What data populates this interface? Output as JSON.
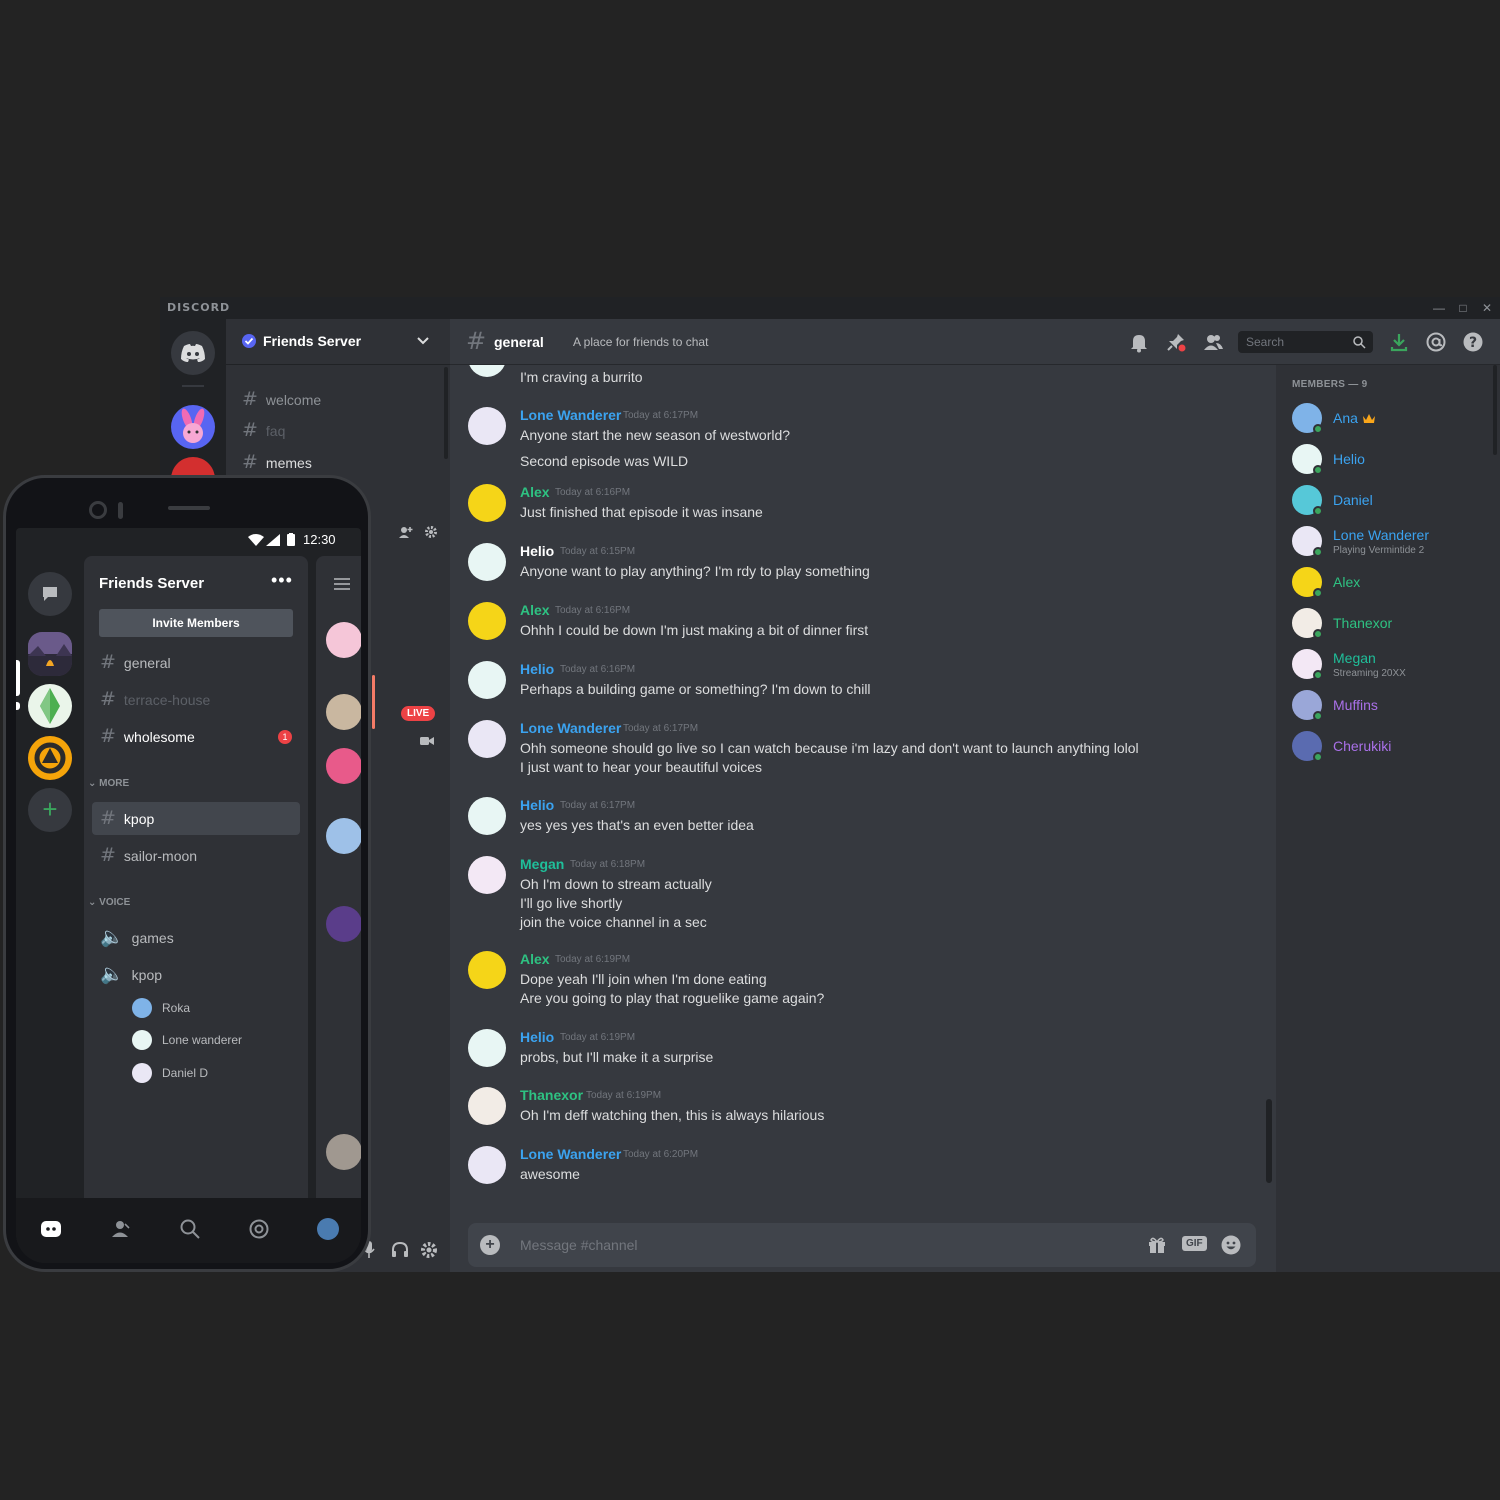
{
  "desktop": {
    "brand": "DISCORD",
    "server": {
      "name": "Friends Server"
    },
    "channels": [
      {
        "name": "welcome",
        "state": "normal"
      },
      {
        "name": "faq",
        "state": "dim"
      },
      {
        "name": "memes",
        "state": "active"
      }
    ],
    "live_label": "LIVE",
    "chat": {
      "channel_name": "general",
      "topic": "A place for friends to chat",
      "search_placeholder": "Search",
      "composer_placeholder": "Message #channel",
      "gif_label": "GIF"
    },
    "messages": [
      {
        "id": "m0",
        "author": "",
        "time": "",
        "lines": [
          "I'm craving a burrito"
        ]
      },
      {
        "id": "m1",
        "author": "Lone Wanderer",
        "time": "Today at 6:17PM",
        "lines": [
          "Anyone start the new season of westworld?"
        ]
      },
      {
        "id": "m1b",
        "author": "",
        "time": "",
        "lines": [
          "Second episode was WILD"
        ]
      },
      {
        "id": "m2",
        "author": "Alex",
        "time": "Today at 6:16PM",
        "lines": [
          "Just finished that episode it was insane"
        ]
      },
      {
        "id": "m3",
        "author": "Helio",
        "time": "Today at 6:15PM",
        "lines": [
          "Anyone want to play anything? I'm rdy to play something"
        ]
      },
      {
        "id": "m4",
        "author": "Alex",
        "time": "Today at 6:16PM",
        "lines": [
          "Ohhh I could be down I'm just making a bit of dinner first"
        ]
      },
      {
        "id": "m5",
        "author": "Helio",
        "time": "Today at 6:16PM",
        "lines": [
          "Perhaps a building game or something? I'm down to chill"
        ]
      },
      {
        "id": "m6",
        "author": "Lone Wanderer",
        "time": "Today at 6:17PM",
        "lines": [
          "Ohh someone should go live so I can watch because i'm lazy and don't want to launch anything lolol",
          "I just want to hear your beautiful voices"
        ]
      },
      {
        "id": "m7",
        "author": "Helio",
        "time": "Today at 6:17PM",
        "lines": [
          "yes yes yes that's an even better idea"
        ]
      },
      {
        "id": "m8",
        "author": "Megan",
        "time": "Today at 6:18PM",
        "lines": [
          "Oh I'm down to stream actually",
          "I'll go live shortly",
          "join the voice channel in a sec"
        ]
      },
      {
        "id": "m9",
        "author": "Alex",
        "time": "Today at 6:19PM",
        "lines": [
          "Dope yeah I'll join when I'm done eating",
          "Are you going to play that roguelike game again?"
        ]
      },
      {
        "id": "m10",
        "author": "Helio",
        "time": "Today at 6:19PM",
        "lines": [
          "probs, but I'll make it a surprise"
        ]
      },
      {
        "id": "m11",
        "author": "Thanexor",
        "time": "Today at 6:19PM",
        "lines": [
          "Oh I'm deff watching then, this is always hilarious"
        ]
      },
      {
        "id": "m12",
        "author": "Lone Wanderer",
        "time": "Today at 6:20PM",
        "lines": [
          "awesome"
        ]
      }
    ],
    "members": {
      "title": "MEMBERS — 9",
      "list": [
        {
          "name": "Ana",
          "sub": ""
        },
        {
          "name": "Helio",
          "sub": ""
        },
        {
          "name": "Daniel",
          "sub": ""
        },
        {
          "name": "Lone Wanderer",
          "sub": "Playing Vermintide 2"
        },
        {
          "name": "Alex",
          "sub": ""
        },
        {
          "name": "Thanexor",
          "sub": ""
        },
        {
          "name": "Megan",
          "sub": "Streaming 20XX"
        },
        {
          "name": "Muffins",
          "sub": ""
        },
        {
          "name": "Cherukiki",
          "sub": ""
        }
      ]
    },
    "colors": {
      "blue": "#3ba3f0",
      "green": "#2ec282",
      "purple": "#a970e8",
      "online": "#3ba55d",
      "danger": "#ed4245"
    }
  },
  "phone": {
    "clock": "12:30",
    "server_name": "Friends Server",
    "more_dots": "•••",
    "invite_label": "Invite Members",
    "channels": [
      {
        "name": "general",
        "state": "normal"
      },
      {
        "name": "terrace-house",
        "state": "dim"
      },
      {
        "name": "wholesome",
        "state": "active",
        "badge": "1"
      }
    ],
    "more_category": "MORE",
    "more_channels": [
      {
        "name": "kpop",
        "state": "selected"
      },
      {
        "name": "sailor-moon",
        "state": "normal"
      }
    ],
    "voice_category": "VOICE",
    "voice_channels": [
      {
        "name": "games"
      },
      {
        "name": "kpop"
      }
    ],
    "voice_users": [
      "Roka",
      "Lone wanderer",
      "Daniel D"
    ]
  }
}
